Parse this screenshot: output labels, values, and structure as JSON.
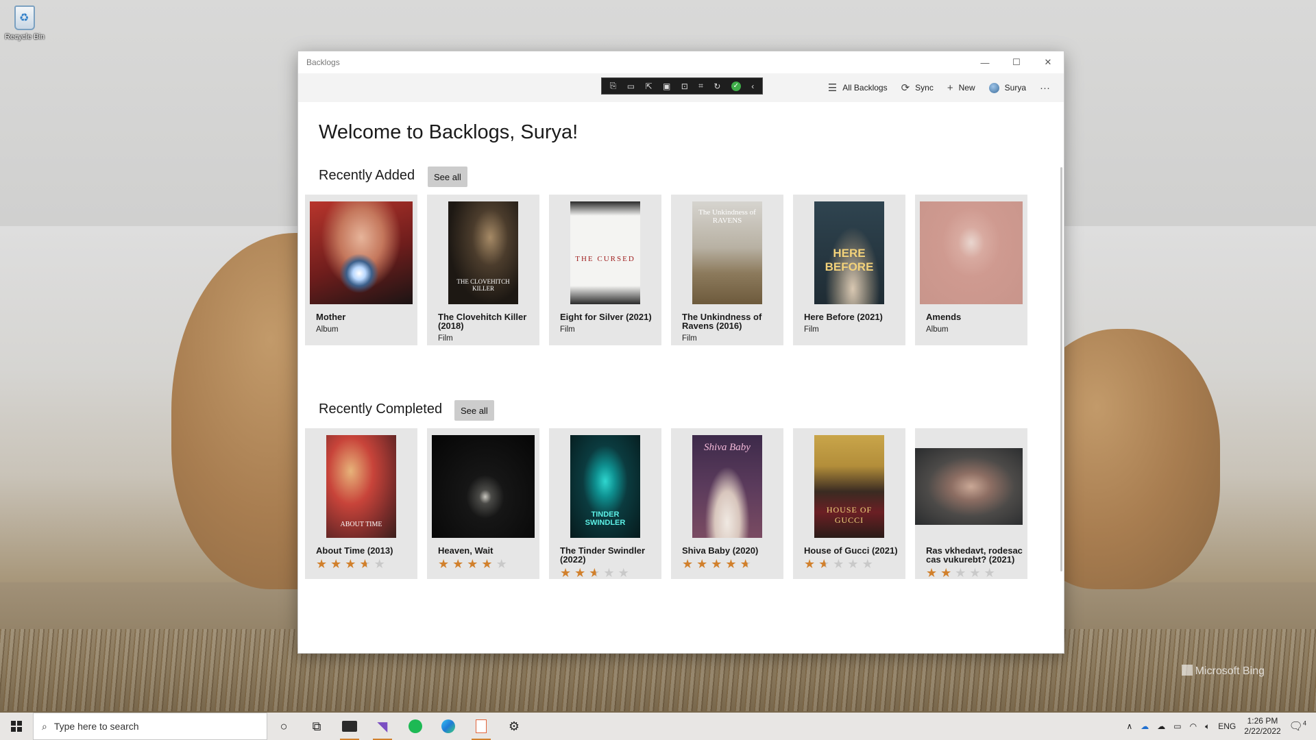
{
  "desktop": {
    "recycle_bin_label": "Recycle Bin",
    "watermark": "Microsoft Bing"
  },
  "window": {
    "title": "Backlogs",
    "controls": {
      "minimize": "—",
      "maximize": "☐",
      "close": "✕"
    }
  },
  "commandbar": {
    "all_backlogs": "All Backlogs",
    "sync": "Sync",
    "new": "New",
    "user": "Surya",
    "more": "···"
  },
  "page": {
    "welcome": "Welcome to Backlogs, Surya!",
    "recently_added_title": "Recently Added",
    "recently_completed_title": "Recently Completed",
    "see_all": "See all"
  },
  "recently_added": [
    {
      "title": "Mother",
      "type": "Album",
      "art": "mother"
    },
    {
      "title": "The Clovehitch Killer (2018)",
      "type": "Film",
      "art": "clovehitch"
    },
    {
      "title": "Eight for Silver (2021)",
      "type": "Film",
      "art": "cursed"
    },
    {
      "title": "The Unkindness of Ravens (2016)",
      "type": "Film",
      "art": "ravens"
    },
    {
      "title": "Here Before (2021)",
      "type": "Film",
      "art": "herebefore"
    },
    {
      "title": "Amends",
      "type": "Album",
      "art": "amends"
    }
  ],
  "recently_completed": [
    {
      "title": "About Time (2013)",
      "rating": 3.5
    },
    {
      "title": "Heaven, Wait",
      "rating": 4
    },
    {
      "title": "The Tinder Swindler (2022)",
      "rating": 2.5
    },
    {
      "title": "Shiva Baby (2020)",
      "rating": 4.5
    },
    {
      "title": "House of Gucci (2021)",
      "rating": 1.5
    },
    {
      "title": "Ras vkhedavt, rodesac cas vukurebt? (2021)",
      "rating": 2
    }
  ],
  "poster_text": {
    "clovehitch": "THE CLOVEHITCH KILLER",
    "cursed": "THE CURSED",
    "ravens": "The Unkindness of RAVENS",
    "herebefore": "HERE BEFORE",
    "about_time": "ABOUT TIME",
    "tinder": "TINDER SWINDLER",
    "shiva": "Shiva Baby",
    "gucci": "HOUSE OF GUCCI"
  },
  "taskbar": {
    "search_placeholder": "Type here to search",
    "language": "ENG",
    "time": "1:26 PM",
    "date": "2/22/2022",
    "notifications": "4"
  },
  "colors": {
    "star_on": "#d1802c",
    "star_off": "#c9c9c9",
    "card_bg": "#e6e6e6"
  }
}
